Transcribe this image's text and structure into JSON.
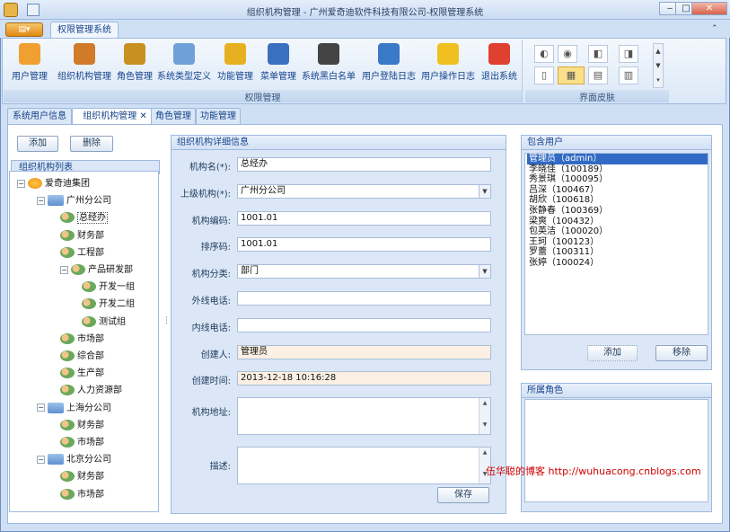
{
  "window": {
    "title": "组织机构管理 - 广州爱奇迪软件科技有限公司-权限管理系统",
    "minimize": "‒",
    "maximize": "□",
    "close": "✕"
  },
  "ribbon": {
    "tab": "权限管理系统",
    "app_menu": "▤▾",
    "buttons": [
      {
        "label": "用户管理",
        "icon": "user-icon",
        "color": "#f0a030"
      },
      {
        "label": "组织机构管理",
        "icon": "users-group-icon",
        "color": "#d07a2a"
      },
      {
        "label": "角色管理",
        "icon": "role-icon",
        "color": "#c89020"
      },
      {
        "label": "系统类型定义",
        "icon": "computer-icon",
        "color": "#6fa0d8"
      },
      {
        "label": "功能管理",
        "icon": "key-icon",
        "color": "#e6b020"
      },
      {
        "label": "菜单管理",
        "icon": "menu-book-icon",
        "color": "#3a70c0"
      },
      {
        "label": "系统黑白名单",
        "icon": "person-silhouette-icon",
        "color": "#444444"
      },
      {
        "label": "用户登陆日志",
        "icon": "checklist-icon",
        "color": "#3a78c8"
      },
      {
        "label": "用户操作日志",
        "icon": "warning-icon",
        "color": "#f0c020"
      },
      {
        "label": "退出系统",
        "icon": "exit-icon",
        "color": "#e04030"
      }
    ],
    "group_label": "权限管理",
    "skin_group_label": "界面皮肤"
  },
  "doc_tabs": [
    {
      "label": "系统用户信息",
      "active": false
    },
    {
      "label": "组织机构管理",
      "active": true,
      "close": "✕"
    },
    {
      "label": "角色管理",
      "active": false
    },
    {
      "label": "功能管理",
      "active": false
    }
  ],
  "left": {
    "add_button": "添加",
    "delete_button": "删除",
    "tree_title": "组织机构列表",
    "tree": [
      {
        "label": "爱奇迪集团",
        "level": 0,
        "type": "org",
        "toggle": "−"
      },
      {
        "label": "广州分公司",
        "level": 1,
        "type": "comp",
        "toggle": "−"
      },
      {
        "label": "总经办",
        "level": 2,
        "type": "dept"
      },
      {
        "label": "财务部",
        "level": 2,
        "type": "dept"
      },
      {
        "label": "工程部",
        "level": 2,
        "type": "dept"
      },
      {
        "label": "产品研发部",
        "level": 2,
        "type": "dept",
        "toggle": "−"
      },
      {
        "label": "开发一组",
        "level": 3,
        "type": "dept"
      },
      {
        "label": "开发二组",
        "level": 3,
        "type": "dept"
      },
      {
        "label": "测试组",
        "level": 3,
        "type": "dept"
      },
      {
        "label": "市场部",
        "level": 2,
        "type": "dept"
      },
      {
        "label": "综合部",
        "level": 2,
        "type": "dept"
      },
      {
        "label": "生产部",
        "level": 2,
        "type": "dept"
      },
      {
        "label": "人力资源部",
        "level": 2,
        "type": "dept"
      },
      {
        "label": "上海分公司",
        "level": 1,
        "type": "comp",
        "toggle": "−"
      },
      {
        "label": "财务部",
        "level": 2,
        "type": "dept"
      },
      {
        "label": "市场部",
        "level": 2,
        "type": "dept"
      },
      {
        "label": "北京分公司",
        "level": 1,
        "type": "comp",
        "toggle": "−"
      },
      {
        "label": "财务部",
        "level": 2,
        "type": "dept"
      },
      {
        "label": "市场部",
        "level": 2,
        "type": "dept"
      }
    ]
  },
  "detail": {
    "title": "组织机构详细信息",
    "fields": [
      {
        "label": "机构名(*):",
        "value": "总经办",
        "kind": "text"
      },
      {
        "label": "上级机构(*):",
        "value": "广州分公司",
        "kind": "select"
      },
      {
        "label": "机构编码:",
        "value": "1001.01",
        "kind": "text"
      },
      {
        "label": "排序码:",
        "value": "1001.01",
        "kind": "text"
      },
      {
        "label": "机构分类:",
        "value": "部门",
        "kind": "select"
      },
      {
        "label": "外线电话:",
        "value": "",
        "kind": "text"
      },
      {
        "label": "内线电话:",
        "value": "",
        "kind": "text"
      },
      {
        "label": "创建人:",
        "value": "管理员",
        "kind": "readonly"
      },
      {
        "label": "创建时间:",
        "value": "2013-12-18 10:16:28",
        "kind": "readonly"
      }
    ],
    "address_label": "机构地址:",
    "desc_label": "描述:",
    "save_button": "保存"
  },
  "users": {
    "title": "包含用户",
    "items": [
      "管理员（admin）",
      "李晓佳（100189）",
      "秀景琪（100095）",
      "吕深（100467）",
      "胡欣（100618）",
      "张静春（100369）",
      "梁爽（100432）",
      "包英洁（100020）",
      "王珂（100123）",
      "罗蕾（100311）",
      "张婷（100024）"
    ],
    "add_button": "添加",
    "remove_button": "移除"
  },
  "roles": {
    "title": "所属角色"
  },
  "watermark": "伍华聪的博客 http://wuhuacong.cnblogs.com"
}
